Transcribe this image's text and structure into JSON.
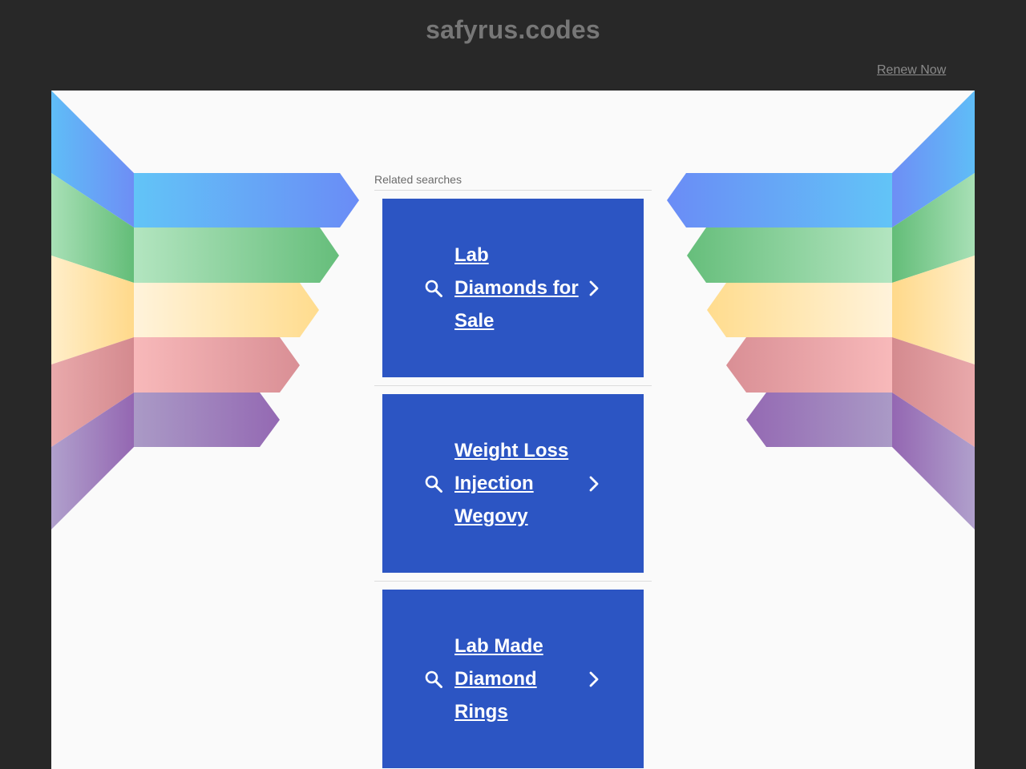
{
  "header": {
    "domain": "safyrus.codes",
    "renew_label": "Renew Now"
  },
  "main": {
    "related_label": "Related searches",
    "items": [
      {
        "label": "Lab Diamonds for Sale"
      },
      {
        "label": "Weight Loss Injection Wegovy"
      },
      {
        "label": "Lab Made Diamond Rings"
      }
    ]
  },
  "icons": {
    "search": "search-icon",
    "chevron": "chevron-right-icon"
  },
  "colors": {
    "page_background": "#282828",
    "content_background": "#fafafa",
    "item_background": "#2c55c3",
    "item_text": "#ffffff",
    "title_text": "#777777",
    "stripes": [
      "#5fb8f6",
      "#6cc17f",
      "#ffd88a",
      "#e7959a",
      "#9a73b8"
    ]
  }
}
